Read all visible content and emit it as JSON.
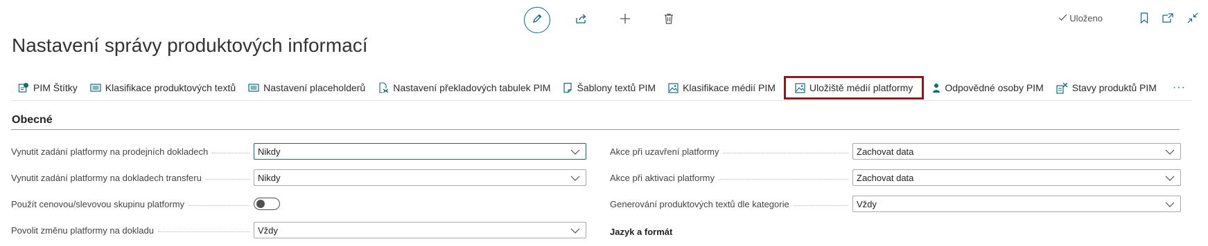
{
  "header": {
    "title": "Nastavení správy produktových informací",
    "status_label": "Uloženo"
  },
  "toolbar": {
    "icons": [
      "pencil-icon",
      "share-icon",
      "plus-icon",
      "trash-icon"
    ]
  },
  "actions": [
    {
      "label": "PIM Štítky",
      "icon": "tag-icon"
    },
    {
      "label": "Klasifikace produktových textů",
      "icon": "list-icon"
    },
    {
      "label": "Nastavení placeholderů",
      "icon": "list-icon"
    },
    {
      "label": "Nastavení překladových tabulek PIM",
      "icon": "translate-icon"
    },
    {
      "label": "Šablony textů PIM",
      "icon": "document-icon"
    },
    {
      "label": "Klasifikace médií PIM",
      "icon": "image-icon"
    },
    {
      "label": "Uložiště médií platformy",
      "icon": "image-icon",
      "highlighted": true
    },
    {
      "label": "Odpovědné osoby PIM",
      "icon": "person-icon"
    },
    {
      "label": "Stavy produktů PIM",
      "icon": "status-icon"
    }
  ],
  "more_label": "···",
  "section": {
    "title": "Obecné",
    "left_fields": [
      {
        "label": "Vynutit zadání platformy na prodejních dokladech",
        "value": "Nikdy",
        "type": "select"
      },
      {
        "label": "Vynutit zadání platformy na dokladech transferu",
        "value": "Nikdy",
        "type": "select"
      },
      {
        "label": "Použít cenovou/slevovou skupinu platformy",
        "value": false,
        "type": "toggle"
      },
      {
        "label": "Povolit změnu platformy na dokladu",
        "value": "Vždy",
        "type": "select"
      }
    ],
    "right_fields": [
      {
        "label": "Akce při uzavření platformy",
        "value": "Zachovat data",
        "type": "select"
      },
      {
        "label": "Akce při aktivaci platformy",
        "value": "Zachovat data",
        "type": "select"
      },
      {
        "label": "Generování produktových textů dle kategorie",
        "value": "Vždy",
        "type": "select"
      }
    ],
    "subheading": "Jazyk a formát"
  },
  "colors": {
    "accent": "#0f6a7a",
    "highlight_border": "#8b1a1f"
  }
}
